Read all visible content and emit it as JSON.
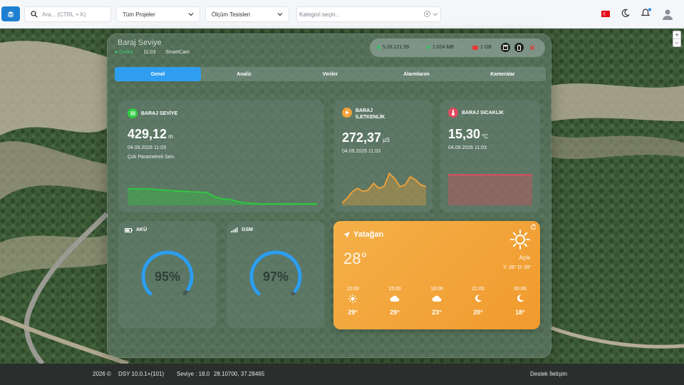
{
  "topbar": {
    "search_placeholder": "Ara... (CTRL + K)",
    "project_select": "Tüm Projeler",
    "facility_select": "Ölçüm Tesisleri",
    "category_placeholder": "Kategori seçin.."
  },
  "panel": {
    "title": "Baraj Seviye",
    "status": "Online",
    "time": "11:03",
    "device": "SmartCam",
    "ip": "5.26.121.59",
    "data_usage": "1.024 MB",
    "quota": "1 GB"
  },
  "tabs": [
    {
      "label": "Genel",
      "active": true
    },
    {
      "label": "Analiz",
      "active": false
    },
    {
      "label": "Veriler",
      "active": false
    },
    {
      "label": "Alarmlarım",
      "active": false
    },
    {
      "label": "Kameralar",
      "active": false
    }
  ],
  "cards": {
    "level": {
      "title": "BARAJ SEVİYE",
      "value": "429,12",
      "unit": "m",
      "date": "04.09.2026 11:03",
      "note": "Çok Parametreli Sen.",
      "color": "#2ecc40",
      "series": [
        0.55,
        0.56,
        0.55,
        0.55,
        0.52,
        0.5,
        0.48,
        0.47,
        0.45,
        0.44,
        0.43,
        0.28,
        0.2,
        0.18,
        0.1,
        0.06,
        0.04,
        0.03,
        0.03,
        0.03,
        0.03,
        0.03,
        0.03,
        0.03,
        0.03
      ]
    },
    "conductivity": {
      "title_line1": "BARAJ",
      "title_line2": "İLETKENLİK",
      "value": "272,37",
      "unit": "µS",
      "date": "04.09.2026 11:03",
      "color": "#f2a23a",
      "series": [
        0.05,
        0.2,
        0.4,
        0.5,
        0.4,
        0.45,
        0.65,
        0.5,
        0.55,
        0.95,
        0.8,
        0.55,
        0.6,
        0.85,
        0.75,
        0.6,
        0.55
      ]
    },
    "temperature": {
      "title": "BARAJ SICAKLIK",
      "value": "15,30",
      "unit": "°C",
      "date": "04.09.2026 11:03",
      "color": "#e24a5e",
      "series": [
        0.95,
        0.95,
        0.95,
        0.95,
        0.95,
        0.95,
        0.95,
        0.95,
        0.95,
        0.95
      ]
    },
    "battery": {
      "title": "AKÜ",
      "percent": 95,
      "label": "95%"
    },
    "gsm": {
      "title": "GSM",
      "percent": 97,
      "label": "97%"
    }
  },
  "weather": {
    "location": "Yatağan",
    "temp": "28°",
    "condition": "Açık",
    "range": "Y: 28° D: 28°",
    "forecast": [
      {
        "time": "12:00",
        "icon": "sun-icon",
        "temp": "29°"
      },
      {
        "time": "15:00",
        "icon": "cloud-icon",
        "temp": "29°"
      },
      {
        "time": "18:00",
        "icon": "cloud-icon",
        "temp": "23°"
      },
      {
        "time": "21:00",
        "icon": "moon-icon",
        "temp": "20°"
      },
      {
        "time": "00:00",
        "icon": "moon-icon",
        "temp": "18°"
      }
    ]
  },
  "statusbar": {
    "year": "2026 ©",
    "version": "DSY  10.0.1+(101)",
    "level": "Seviye : 18.0",
    "coords": "28.10700, 37.28465",
    "support": "Destek İletişim"
  }
}
